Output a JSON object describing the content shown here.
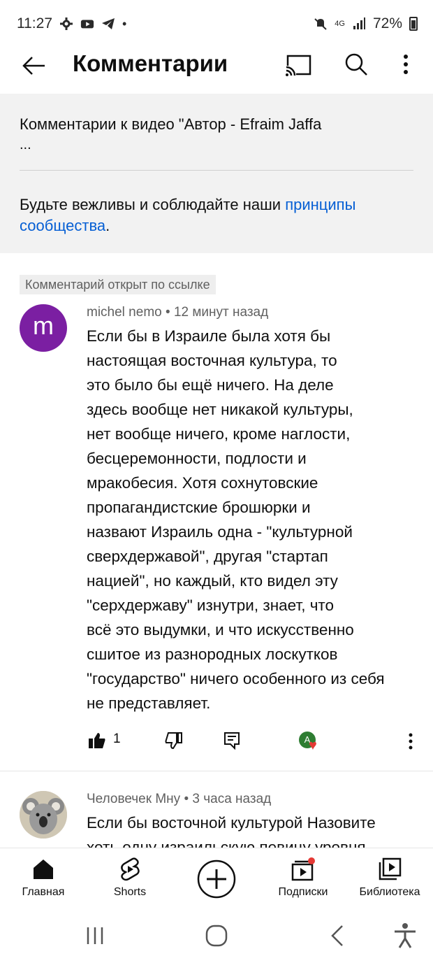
{
  "status_bar": {
    "time": "11:27",
    "battery": "72%",
    "network": "4G"
  },
  "app_bar": {
    "title": "Комментарии"
  },
  "header": {
    "video_title": "Комментарии к видео \"Автор - Efraim Jaffa",
    "ellipsis": "...",
    "guidelines_prefix": "Будьте вежливы и соблюдайте наши ",
    "guidelines_link": "принципы сообщества",
    "guidelines_suffix": "."
  },
  "comments": [
    {
      "badge": "Комментарий открыт по ссылке",
      "avatar_letter": "m",
      "author": "michel nemo",
      "time": "12 минут назад",
      "text": "Если бы в Израиле была хотя бы\nнастоящая восточная культура, то\nэто было бы ещё ничего. На деле\nздесь вообще нет никакой культуры,\nнет вообще ничего, кроме наглости,\nбесцеремонности, подлости и\nмракобесия. Хотя сохнутовские\nпропагандистские брошюрки и\nназвают Израиль одна -  \"культурной\nсверхдержавой\", другая \"стартап\nнацией\", но каждый, кто видел эту\n\"серхдержаву\" изнутри, знает, что\nвсё это выдумки, и что искусственно\nсшитое из разнородных лоскутков\n\"государство\" ничего особенного из себя\nне представляет.",
      "likes": "1",
      "creator_avatar_letter": "A"
    },
    {
      "author": "Человечек Мну",
      "time": "3 часа назад",
      "text": "Если бы восточной культурой Назовите\nхоть одну израильскую певицу уровня"
    }
  ],
  "meta_separator": " • ",
  "bottom_nav": {
    "items": [
      {
        "label": "Главная"
      },
      {
        "label": "Shorts"
      },
      {
        "label": "Подписки"
      },
      {
        "label": "Библиотека"
      }
    ]
  },
  "colors": {
    "link": "#065fd4",
    "avatar_m": "#7b1fa2",
    "notification_dot": "#e53935"
  }
}
